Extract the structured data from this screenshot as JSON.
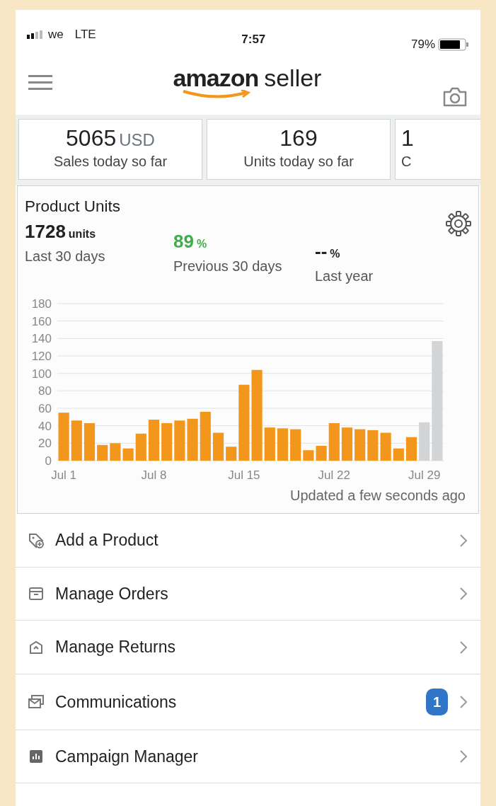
{
  "status_bar": {
    "carrier": "we",
    "network": "LTE",
    "time": "7:57",
    "battery": "79%"
  },
  "header": {
    "logo_word": "amazon",
    "logo_suffix": "seller"
  },
  "kpi_cards": [
    {
      "value": "5065",
      "unit": "USD",
      "label": "Sales today so far"
    },
    {
      "value": "169",
      "label": "Units today so far"
    },
    {
      "value": "1",
      "label": "C"
    }
  ],
  "product_units": {
    "title": "Product Units",
    "stats": [
      {
        "value": "1728",
        "unit": "units",
        "label": "Last 30 days",
        "kind": "plain"
      },
      {
        "value": "89",
        "unit": "%",
        "label": "Previous 30 days",
        "kind": "positive"
      },
      {
        "value": "--",
        "unit": "%",
        "label": "Last year",
        "kind": "plain"
      }
    ],
    "chart_data": {
      "type": "bar",
      "stacked": true,
      "grid": true,
      "categories": [
        "Jul 1",
        null,
        null,
        null,
        null,
        null,
        null,
        "Jul 8",
        null,
        null,
        null,
        null,
        null,
        null,
        "Jul 15",
        null,
        null,
        null,
        null,
        null,
        null,
        "Jul 22",
        null,
        null,
        null,
        null,
        null,
        null,
        "Jul 29",
        null
      ],
      "ylim": [
        0,
        180
      ],
      "yticks": [
        0,
        20,
        40,
        60,
        80,
        100,
        120,
        140,
        160,
        180
      ],
      "series": [
        {
          "color": "#f3961c",
          "values": [
            55,
            46,
            43,
            18,
            20,
            14,
            31,
            47,
            43,
            46,
            48,
            56,
            32,
            16,
            87,
            104,
            38,
            37,
            36,
            12,
            17,
            43,
            38,
            36,
            35,
            32,
            14,
            27,
            null,
            null
          ]
        },
        {
          "color": "#d3d4d6",
          "values": [
            null,
            null,
            null,
            null,
            null,
            null,
            null,
            null,
            null,
            null,
            null,
            null,
            null,
            null,
            null,
            null,
            null,
            null,
            null,
            null,
            null,
            null,
            null,
            null,
            null,
            null,
            null,
            null,
            44,
            137
          ]
        }
      ]
    },
    "updated": "Updated a few seconds ago"
  },
  "menu": [
    {
      "label": "Add a Product"
    },
    {
      "label": "Manage Orders"
    },
    {
      "label": "Manage Returns"
    },
    {
      "label": "Communications",
      "badge": "1"
    },
    {
      "label": "Campaign Manager"
    }
  ]
}
